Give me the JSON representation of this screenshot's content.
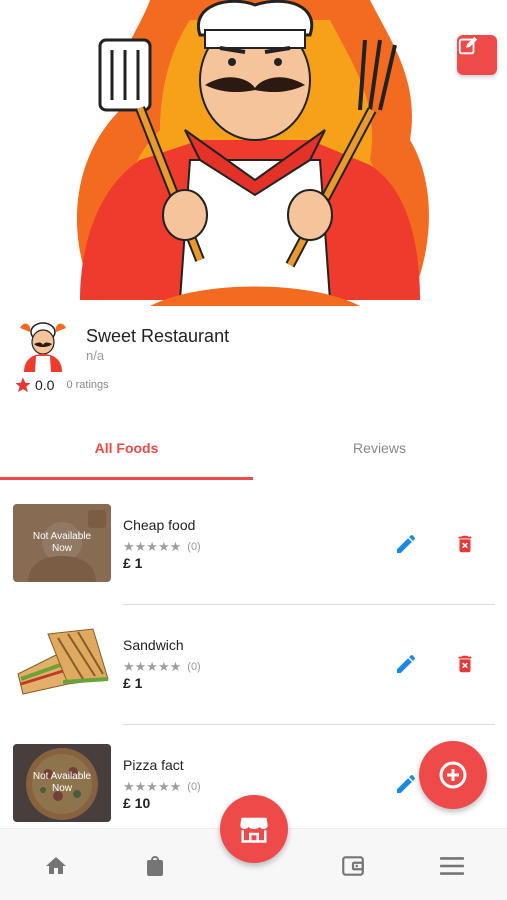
{
  "header": {
    "cover_image": "chef-mascot-cover",
    "edit_icon": "edit-square-icon"
  },
  "restaurant": {
    "name": "Sweet Restaurant",
    "address": "n/a",
    "rating": "0.0",
    "ratings_count": "0 ratings"
  },
  "tabs": [
    {
      "label": "All Foods",
      "active": true
    },
    {
      "label": "Reviews",
      "active": false
    }
  ],
  "foods": [
    {
      "name": "Cheap food",
      "stars": "★★★★★",
      "reviews": "(0)",
      "price": "£ 1",
      "available": false,
      "overlay": "Not Available Now",
      "image": "chef-avatar-image"
    },
    {
      "name": "Sandwich",
      "stars": "★★★★★",
      "reviews": "(0)",
      "price": "£ 1",
      "available": true,
      "overlay": "",
      "image": "sandwich-image"
    },
    {
      "name": "Pizza fact",
      "stars": "★★★★★",
      "reviews": "(0)",
      "price": "£ 10",
      "available": false,
      "overlay": "Not Available Now",
      "image": "pizza-image"
    }
  ],
  "bottom_nav": {
    "items": [
      "home-icon",
      "shopping-bag-icon",
      "store-icon",
      "wallet-icon",
      "menu-icon"
    ]
  },
  "colors": {
    "accent": "#ee4a4a",
    "edit_blue": "#1e88e5",
    "star_red": "#e53935",
    "star_grey": "#9e9e9e"
  }
}
